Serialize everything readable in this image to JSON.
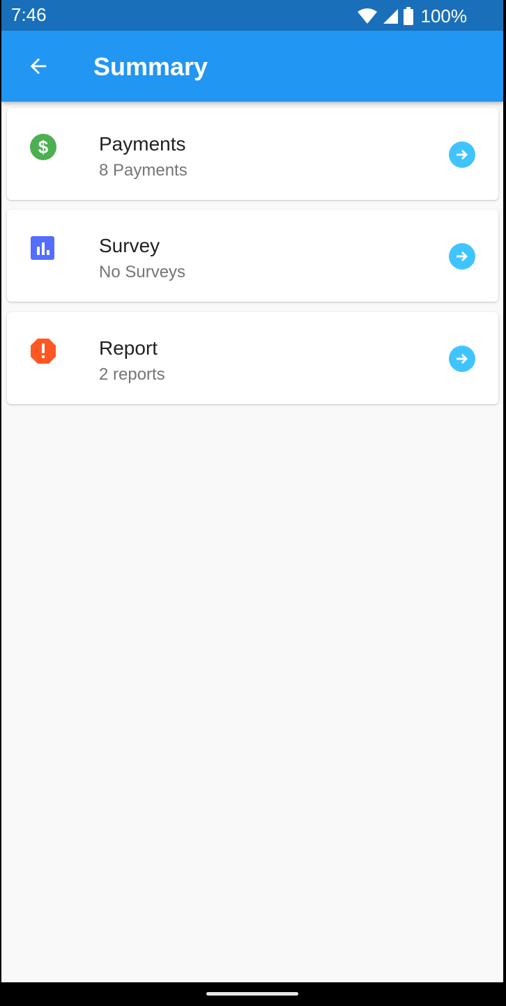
{
  "status_bar": {
    "time": "7:46",
    "battery_text": "100%",
    "icons": [
      "wifi-icon",
      "cell-signal-icon",
      "battery-icon"
    ]
  },
  "app_bar": {
    "title": "Summary",
    "back_icon": "arrow-left-icon",
    "color": "#2196f3"
  },
  "items": [
    {
      "title": "Payments",
      "subtitle": "8 Payments",
      "icon": "dollar-circle-icon",
      "icon_color": "#4caf50"
    },
    {
      "title": "Survey",
      "subtitle": "No Surveys",
      "icon": "bar-chart-icon",
      "icon_color": "#536dfe"
    },
    {
      "title": "Report",
      "subtitle": "2 reports",
      "icon": "alert-octagon-icon",
      "icon_color": "#ff5722"
    }
  ],
  "arrow_icon": {
    "name": "arrow-right-circle-icon",
    "color": "#40c4ff"
  }
}
